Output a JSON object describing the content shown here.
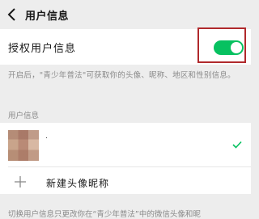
{
  "nav": {
    "title": "用户信息"
  },
  "auth": {
    "label": "授权用户信息",
    "enabled": true,
    "accent_color": "#07c160"
  },
  "description": "开启后，\"青少年普法\"可获取你的头像、昵称、地区和性别信息。",
  "section": {
    "label": "用户信息"
  },
  "user": {
    "name": "."
  },
  "new_avatar": {
    "label": "新建头像昵称"
  },
  "footer_note": "切换用户信息只更改你在“青少年普法”中的微信头像和昵"
}
